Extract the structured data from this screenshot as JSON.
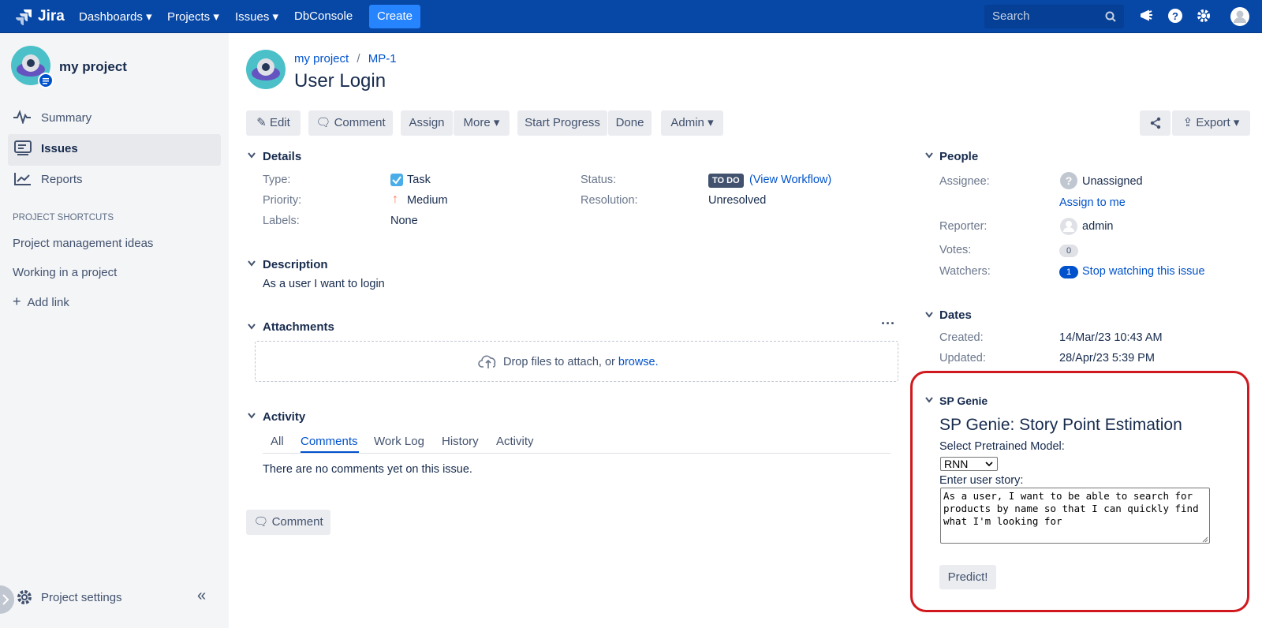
{
  "topnav": {
    "logo": "Jira",
    "dashboards": "Dashboards",
    "projects": "Projects",
    "issues": "Issues",
    "dbconsole": "DbConsole",
    "create": "Create",
    "search_placeholder": "Search"
  },
  "sidebar": {
    "project_name": "my project",
    "items": [
      {
        "label": "Summary"
      },
      {
        "label": "Issues"
      },
      {
        "label": "Reports"
      }
    ],
    "shortcuts_heading": "PROJECT SHORTCUTS",
    "shortcuts": [
      {
        "label": "Project management ideas"
      },
      {
        "label": "Working in a project"
      }
    ],
    "add_link": "Add link",
    "settings": "Project settings"
  },
  "breadcrumb": {
    "project": "my project",
    "sep": "/",
    "issue_key": "MP-1"
  },
  "issue": {
    "title": "User Login"
  },
  "toolbar": {
    "edit": "Edit",
    "comment": "Comment",
    "assign": "Assign",
    "more": "More",
    "start_progress": "Start Progress",
    "done": "Done",
    "admin": "Admin",
    "export": "Export"
  },
  "details": {
    "heading": "Details",
    "type_label": "Type:",
    "type_value": "Task",
    "priority_label": "Priority:",
    "priority_value": "Medium",
    "labels_label": "Labels:",
    "labels_value": "None",
    "status_label": "Status:",
    "status_badge": "TO DO",
    "view_workflow": "(View Workflow)",
    "resolution_label": "Resolution:",
    "resolution_value": "Unresolved"
  },
  "description": {
    "heading": "Description",
    "text": "As a user I want to login"
  },
  "attachments": {
    "heading": "Attachments",
    "drop_text": "Drop files to attach, or",
    "browse": "browse."
  },
  "activity": {
    "heading": "Activity",
    "tabs": [
      "All",
      "Comments",
      "Work Log",
      "History",
      "Activity"
    ],
    "active_tab": "Comments",
    "empty_text": "There are no comments yet on this issue.",
    "comment_button": "Comment"
  },
  "people": {
    "heading": "People",
    "assignee_label": "Assignee:",
    "assignee_value": "Unassigned",
    "assign_to_me": "Assign to me",
    "reporter_label": "Reporter:",
    "reporter_value": "admin",
    "votes_label": "Votes:",
    "votes_count": "0",
    "watchers_label": "Watchers:",
    "watchers_count": "1",
    "stop_watching": "Stop watching this issue"
  },
  "dates": {
    "heading": "Dates",
    "created_label": "Created:",
    "created_value": "14/Mar/23 10:43 AM",
    "updated_label": "Updated:",
    "updated_value": "28/Apr/23 5:39 PM"
  },
  "sp_genie": {
    "heading": "SP Genie",
    "title": "SP Genie: Story Point Estimation",
    "model_label": "Select Pretrained Model:",
    "model_selected": "RNN",
    "story_label": "Enter user story:",
    "story_text": "As a user, I want to be able to search for products by name so that I can quickly find what I'm looking for",
    "predict_button": "Predict!"
  },
  "colors": {
    "nav_bg": "#0747a6",
    "create_btn": "#2684ff",
    "link": "#0052cc",
    "highlight_border": "#d0191f",
    "status_badge": "#42526e"
  }
}
